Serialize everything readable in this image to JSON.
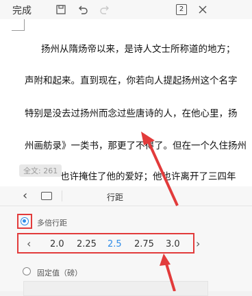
{
  "toolbar": {
    "done_label": "完成",
    "page_count": "2",
    "icons": [
      "save-icon",
      "undo-icon",
      "redo-icon",
      "page-count-icon",
      "close-icon"
    ]
  },
  "document": {
    "lines": [
      "扬州从隋炀帝以来，是诗人文士所称道的地方；",
      "声附和起来。直到现在，你若向人提起扬州这个名字",
      "特别是没去过扬州而念过些唐诗的人，在他心里，扬",
      "州画舫录》一类书，那更了不得了。但在一个久住扬州",
      "也许掩住了他的爱好；他也许离开了三四年"
    ],
    "word_count": "全文: 261"
  },
  "panel": {
    "title": "行距",
    "multiple_label": "多倍行距",
    "fixed_label": "固定值（磅）",
    "values": [
      "2.0",
      "2.25",
      "2.5",
      "2.75",
      "3.0"
    ],
    "selected_value": "2.5"
  },
  "colors": {
    "accent": "#2f8ce8",
    "annotation": "#e23b3b"
  }
}
